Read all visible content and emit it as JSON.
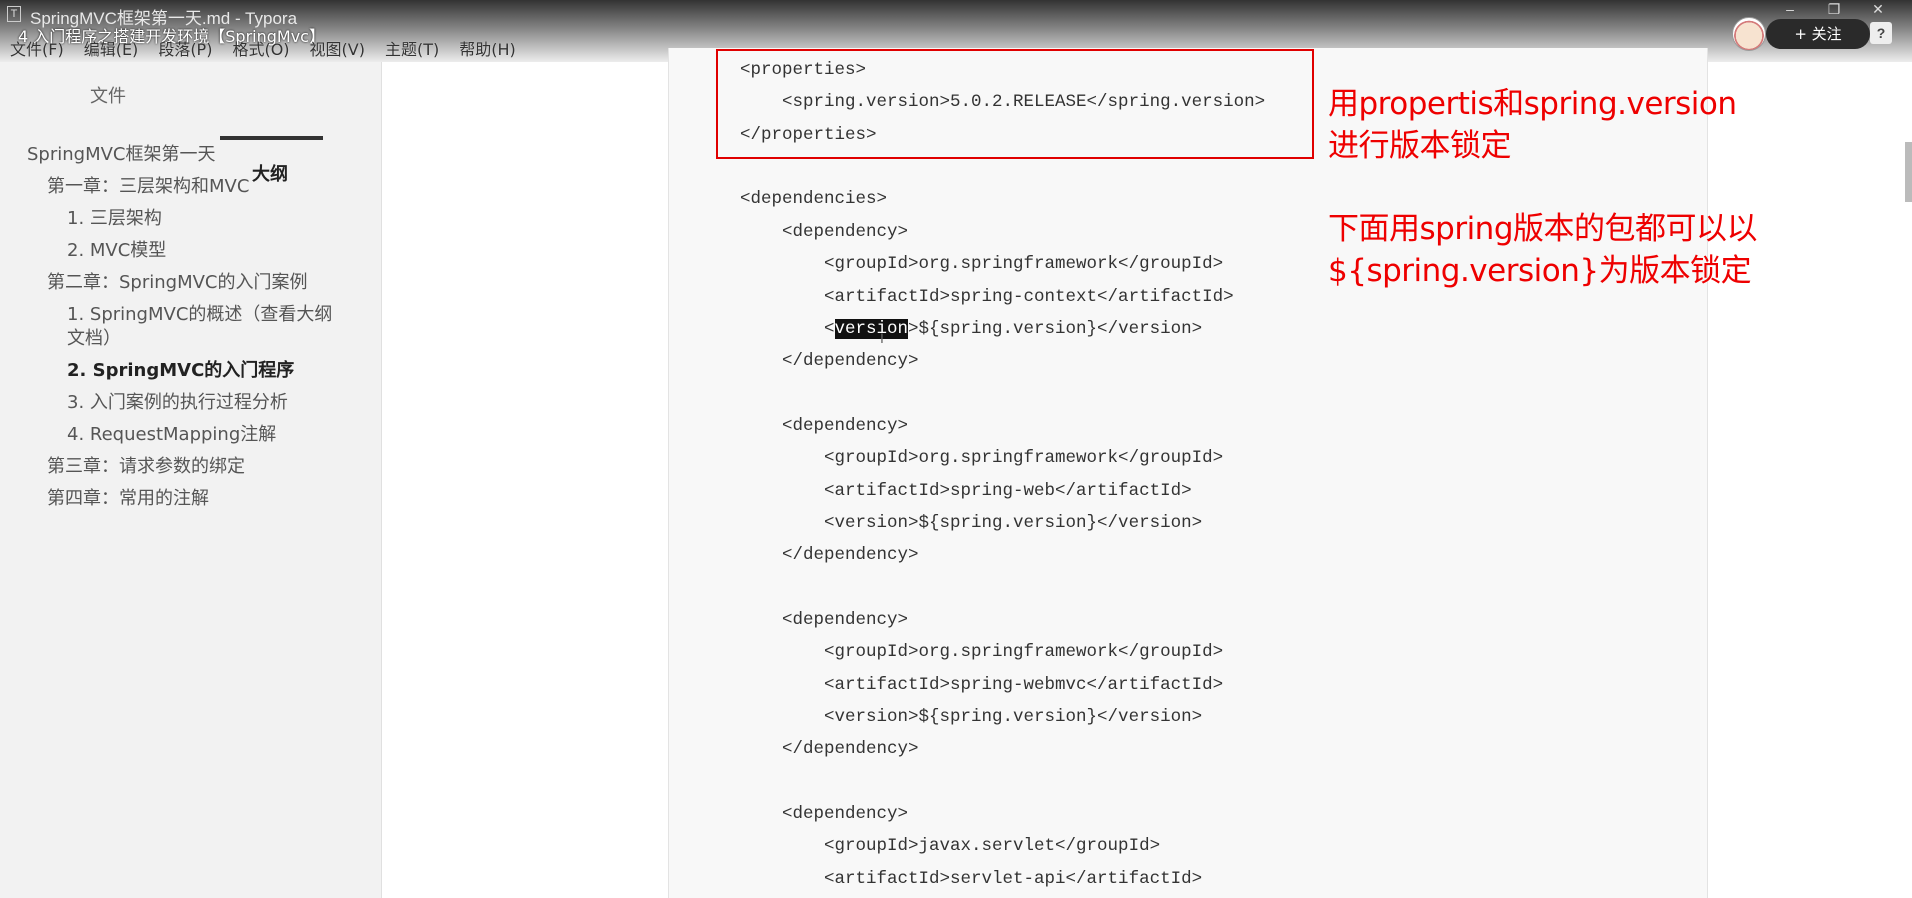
{
  "window": {
    "title": "SpringMVC框架第一天.md - Typora",
    "video_title": "4 入门程序之搭建开发环境【SpringMvc】",
    "menu": [
      "文件(F)",
      "编辑(E)",
      "段落(P)",
      "格式(O)",
      "视图(V)",
      "主题(T)",
      "帮助(H)"
    ],
    "follow_label": "+ 关注",
    "help_label": "?"
  },
  "sidebar": {
    "tabs": [
      "文件",
      "大纲"
    ],
    "active_tab": "大纲",
    "outline": [
      {
        "label": "SpringMVC框架第一天",
        "level": 1
      },
      {
        "label": "第一章：三层架构和MVC",
        "level": 2
      },
      {
        "label": "1. 三层架构",
        "level": 3
      },
      {
        "label": "2. MVC模型",
        "level": 3
      },
      {
        "label": "第二章：SpringMVC的入门案例",
        "level": 2
      },
      {
        "label": "1. SpringMVC的概述（查看大纲",
        "level": 3
      },
      {
        "label": "文档）",
        "level": 3
      },
      {
        "label": "2. SpringMVC的入门程序",
        "level": 3,
        "active": true
      },
      {
        "label": "3. 入门案例的执行过程分析",
        "level": 3
      },
      {
        "label": "4. RequestMapping注解",
        "level": 3
      },
      {
        "label": "第三章：请求参数的绑定",
        "level": 2
      },
      {
        "label": "第四章：常用的注解",
        "level": 2
      }
    ]
  },
  "code": {
    "lines": [
      "<properties>",
      "    <spring.version>5.0.2.RELEASE</spring.version>",
      "</properties>",
      "",
      "<dependencies>",
      "    <dependency>",
      "        <groupId>org.springframework</groupId>",
      "        <artifactId>spring-context</artifactId>",
      "        <version>${spring.version}</version>",
      "    </dependency>",
      "",
      "    <dependency>",
      "        <groupId>org.springframework</groupId>",
      "        <artifactId>spring-web</artifactId>",
      "        <version>${spring.version}</version>",
      "    </dependency>",
      "",
      "    <dependency>",
      "        <groupId>org.springframework</groupId>",
      "        <artifactId>spring-webmvc</artifactId>",
      "        <version>${spring.version}</version>",
      "    </dependency>",
      "",
      "    <dependency>",
      "        <groupId>javax.servlet</groupId>",
      "        <artifactId>servlet-api</artifactId>"
    ],
    "selected_text": "version"
  },
  "annotations": [
    "用propertis和spring.version",
    "进行版本锁定",
    "下面用spring版本的包都可以以",
    "${spring.version}为版本锁定"
  ],
  "colors": {
    "annotation_red": "#ee0000",
    "sidebar_bg": "#f2f2f2",
    "code_bg": "#f8f8f8"
  }
}
